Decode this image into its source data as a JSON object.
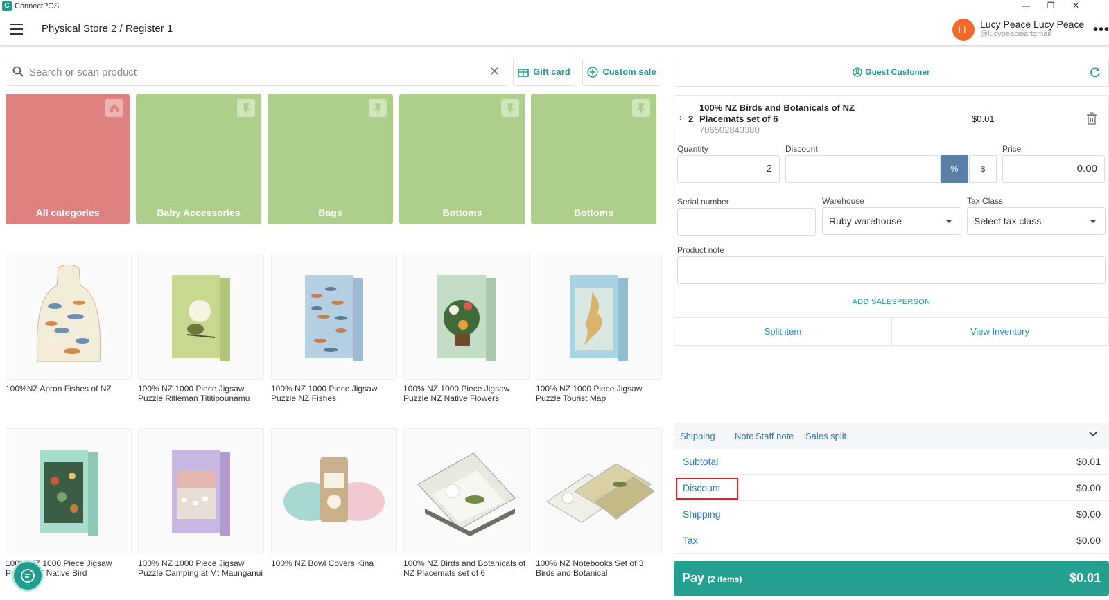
{
  "window": {
    "app_title": "ConnectPOS",
    "app_icon": "C",
    "minimize": "—",
    "restore": "❐",
    "close": "✕"
  },
  "header": {
    "store_title": "Physical Store 2 / Register 1",
    "avatar_initials": "LL",
    "user_name": "Lucy Peace Lucy Peace",
    "user_email": "@lucypeaceiartgmail",
    "more": "•••"
  },
  "search": {
    "placeholder": "Search or scan product",
    "value": "",
    "clear": "✕"
  },
  "buttons": {
    "gift_card": "Gift card",
    "custom_sale": "Custom sale"
  },
  "categories": [
    {
      "label": "All categories",
      "icon": "home-icon"
    },
    {
      "label": "Baby Accessories",
      "icon": "pin-icon"
    },
    {
      "label": "Bags",
      "icon": "pin-icon"
    },
    {
      "label": "Bottoms",
      "icon": "pin-icon"
    },
    {
      "label": "Bottoms",
      "icon": "pin-icon"
    }
  ],
  "products": [
    {
      "name": "100%NZ Apron Fishes of NZ"
    },
    {
      "name": "100% NZ 1000 Piece Jigsaw Puzzle Rifleman Tititipounamu"
    },
    {
      "name": "100% NZ 1000 Piece Jigsaw Puzzle NZ Fishes"
    },
    {
      "name": "100% NZ 1000 Piece Jigsaw Puzzle NZ Native Flowers"
    },
    {
      "name": "100% NZ 1000 Piece Jigsaw Puzzle Tourist Map"
    },
    {
      "name": "100% NZ 1000 Piece Jigsaw Puzzle NZ Native Bird"
    },
    {
      "name": "100% NZ 1000 Piece Jigsaw Puzzle Camping at Mt Maunganui"
    },
    {
      "name": "100% NZ Bowl Covers Kina"
    },
    {
      "name": "100% NZ Birds and Botanicals of NZ Placemats set of 6"
    },
    {
      "name": "100% NZ Notebooks Set of 3 Birds and Botanical"
    }
  ],
  "customer": {
    "label": "Guest Customer"
  },
  "cart_item": {
    "quantity_badge": "2",
    "name": "100% NZ Birds and Botanicals of NZ Placemats set of 6",
    "sku": "706502843380",
    "price": "$0.01"
  },
  "item_form": {
    "quantity_label": "Quantity",
    "quantity_value": "2",
    "discount_label": "Discount",
    "discount_value": "",
    "percent_label": "%",
    "dollar_label": "$",
    "price_label": "Price",
    "price_value": "0.00",
    "serial_label": "Serial number",
    "serial_value": "",
    "warehouse_label": "Warehouse",
    "warehouse_value": "Ruby warehouse",
    "tax_class_label": "Tax Class",
    "tax_class_value": "Select tax class",
    "note_label": "Product note",
    "note_value": "",
    "add_salesperson": "ADD SALESPERSON",
    "split_item": "Split item",
    "view_inventory": "View Inventory"
  },
  "order_tabs": [
    "Shipping",
    "Note",
    "Staff note",
    "Sales split"
  ],
  "totals": [
    {
      "label": "Subtotal",
      "value": "$0.01"
    },
    {
      "label": "Discount",
      "value": "$0.00"
    },
    {
      "label": "Shipping",
      "value": "$0.00"
    },
    {
      "label": "Tax",
      "value": "$0.00"
    }
  ],
  "pay": {
    "label": "Pay",
    "items": "(2 items)",
    "amount": "$0.01"
  },
  "colors": {
    "accent": "#23a08f",
    "link": "#2b7bb8",
    "category_red": "#dd8181",
    "category_green": "#aecf8c",
    "highlight": "#e02020"
  }
}
